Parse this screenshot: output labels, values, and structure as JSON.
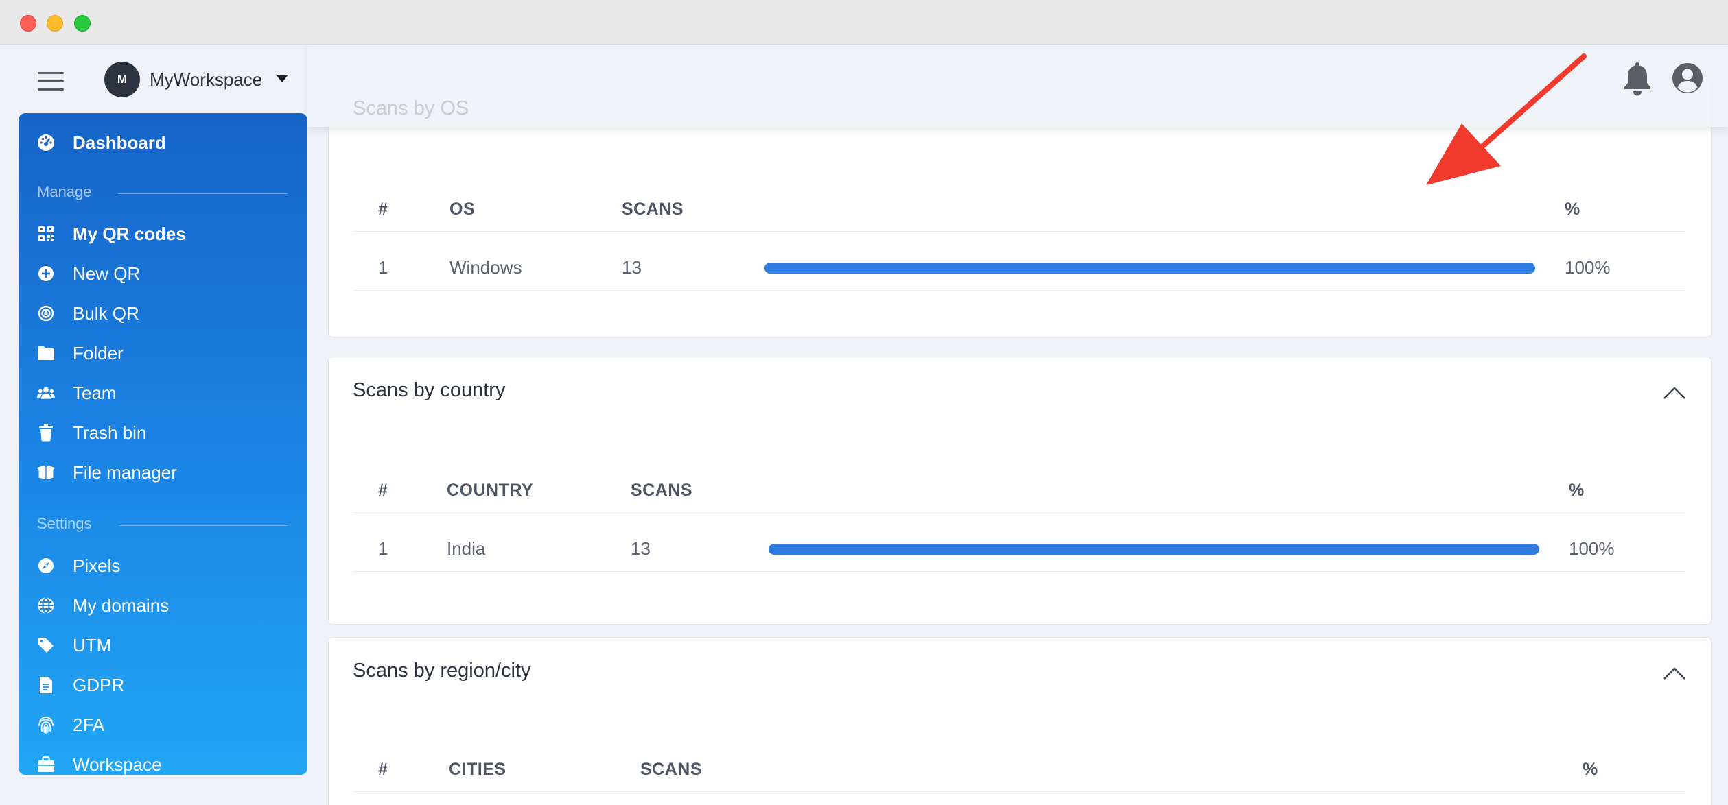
{
  "window": {
    "colors": {
      "close": "#fe5f57",
      "minimize": "#febc2e",
      "zoom": "#28c840"
    }
  },
  "header": {
    "workspace_initial": "M",
    "workspace_name": "MyWorkspace",
    "icons": [
      "menu-icon",
      "chevron-down-icon",
      "bell-icon",
      "user-circle-icon"
    ]
  },
  "sidebar": {
    "dashboard": "Dashboard",
    "manage_label": "Manage",
    "manage": [
      {
        "label": "My QR codes",
        "icon": "qr-code-icon"
      },
      {
        "label": "New QR",
        "icon": "plus-circle-icon"
      },
      {
        "label": "Bulk QR",
        "icon": "target-icon"
      },
      {
        "label": "Folder",
        "icon": "folder-icon"
      },
      {
        "label": "Team",
        "icon": "users-icon"
      },
      {
        "label": "Trash bin",
        "icon": "trash-icon"
      },
      {
        "label": "File manager",
        "icon": "box-open-icon"
      }
    ],
    "settings_label": "Settings",
    "settings": [
      {
        "label": "Pixels",
        "icon": "compass-icon"
      },
      {
        "label": "My domains",
        "icon": "globe-icon"
      },
      {
        "label": "UTM",
        "icon": "tag-icon"
      },
      {
        "label": "GDPR",
        "icon": "file-icon"
      },
      {
        "label": "2FA",
        "icon": "fingerprint-icon"
      },
      {
        "label": "Workspace",
        "icon": "briefcase-icon"
      }
    ],
    "colors": {
      "gradient_top": "#1663c6",
      "gradient_bottom": "#21a6f5"
    }
  },
  "content": {
    "ghost_title": "Scans by OS",
    "os_card": {
      "headers": {
        "num": "#",
        "name": "OS",
        "scans": "SCANS",
        "pct": "%"
      },
      "rows": [
        {
          "num": "1",
          "name": "Windows",
          "scans": "13",
          "pct": "100%",
          "fill": 1.0
        }
      ]
    },
    "country_card": {
      "title": "Scans by country",
      "headers": {
        "num": "#",
        "name": "COUNTRY",
        "scans": "SCANS",
        "pct": "%"
      },
      "rows": [
        {
          "num": "1",
          "name": "India",
          "scans": "13",
          "pct": "100%",
          "fill": 1.0
        }
      ]
    },
    "city_card": {
      "title": "Scans by region/city",
      "headers": {
        "num": "#",
        "name": "CITIES",
        "scans": "SCANS",
        "pct": "%"
      }
    },
    "colors": {
      "bar": "#2f7de1",
      "annotation_arrow": "#f03a2e"
    }
  }
}
